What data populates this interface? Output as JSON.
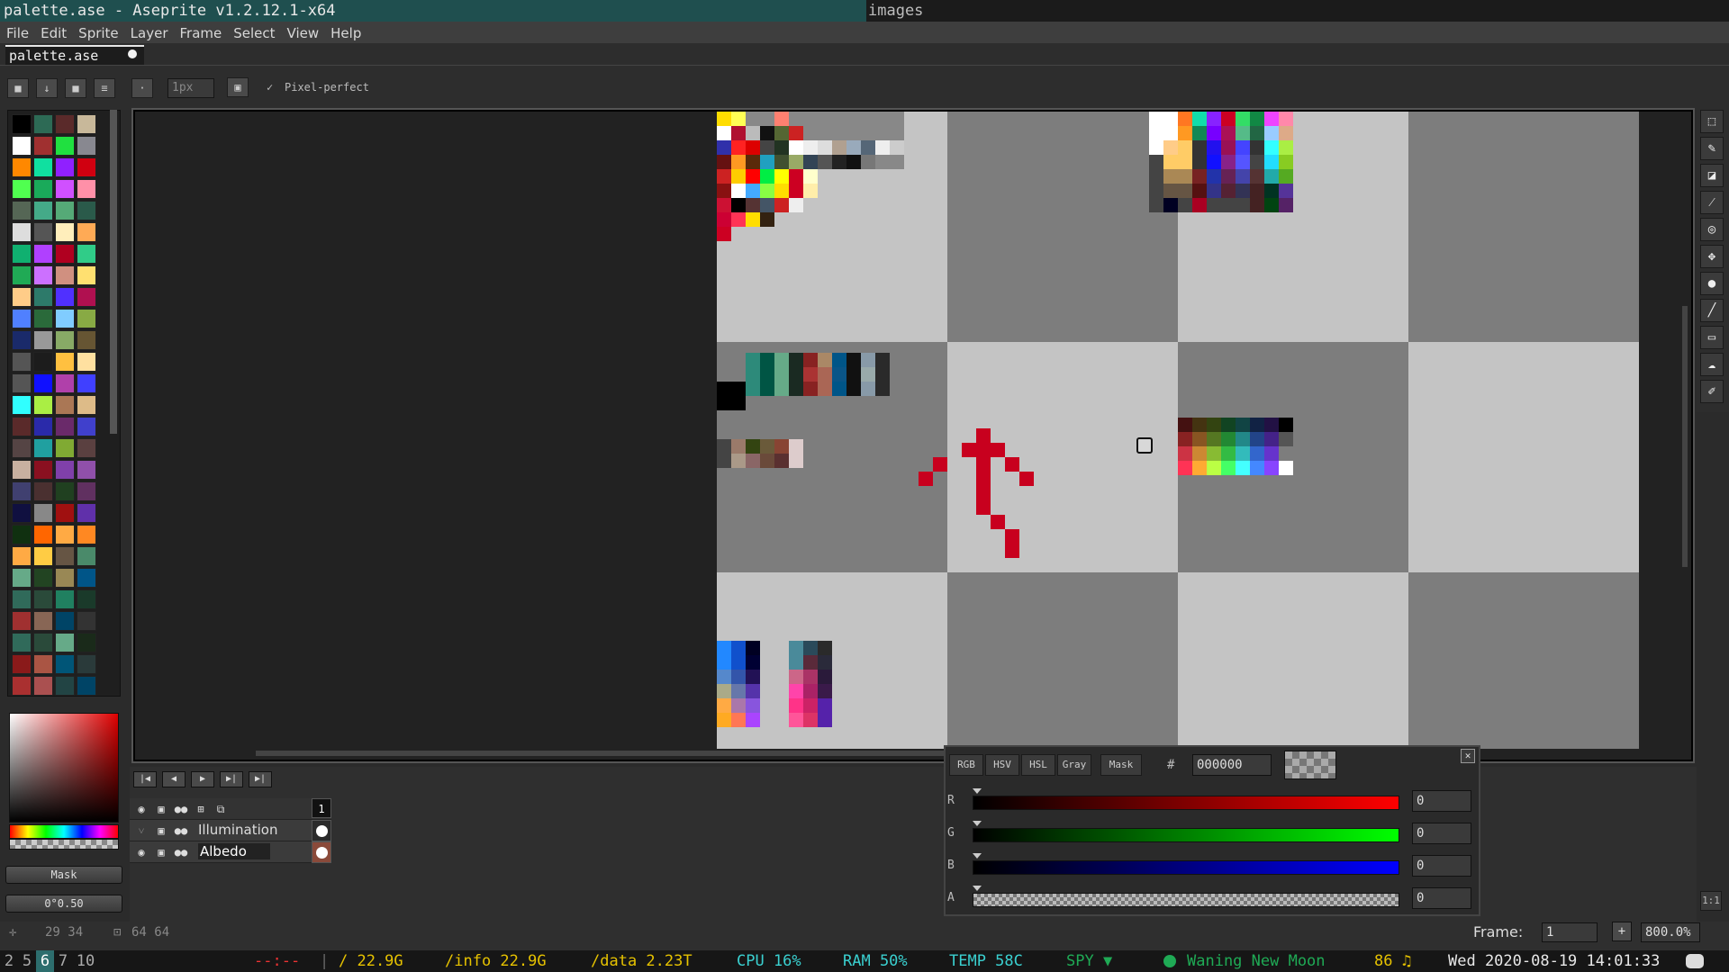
{
  "window": {
    "title": "palette.ase - Aseprite v1.2.12.1-x64",
    "right_title": "images"
  },
  "menu": [
    "File",
    "Edit",
    "Sprite",
    "Layer",
    "Frame",
    "Select",
    "View",
    "Help"
  ],
  "tab": {
    "label": "palette.ase"
  },
  "context_bar": {
    "brush_size": "1px",
    "pixel_perfect_label": "Pixel-perfect"
  },
  "side_buttons": {
    "mask": "Mask",
    "angle": "0°0.50"
  },
  "layers": [
    {
      "name": "Illumination"
    },
    {
      "name": "Albedo"
    }
  ],
  "frame_header": "1",
  "color_dialog": {
    "modes": [
      "RGB",
      "HSV",
      "HSL",
      "Gray",
      "Mask"
    ],
    "hex_label": "#",
    "hex_value": "000000",
    "channels": [
      {
        "label": "R",
        "value": "0"
      },
      {
        "label": "G",
        "value": "0"
      },
      {
        "label": "B",
        "value": "0"
      },
      {
        "label": "A",
        "value": "0"
      }
    ]
  },
  "status": {
    "cursor": "29 34",
    "size": "64 64",
    "frame_label": "Frame:",
    "frame_value": "1",
    "zoom": "800.0%"
  },
  "sysbar": {
    "workspaces": [
      "2",
      "5",
      "6",
      "7",
      "10"
    ],
    "active_workspace": "6",
    "clock_dashes": "--:--",
    "root": "/ 22.9G",
    "info": "/info 22.9G",
    "data": "/data 2.23T",
    "cpu": "CPU 16%",
    "ram": "RAM 50%",
    "temp": "TEMP 58C",
    "spy": "SPY ▼",
    "moon": "Waning New Moon",
    "volume": "86 ♫",
    "datetime": "Wed 2020-08-19 14:01:33"
  },
  "colors": {
    "title_bg": "#1f4f4f",
    "accent_teal": "#2d6e6e",
    "status_green": "#1faa55",
    "status_red": "#e33",
    "status_yellow": "#e6c200",
    "status_cyan": "#3ad0d0",
    "ink_red": "#c8001e"
  },
  "icons": [
    "lock-icon",
    "arrow-down-icon",
    "square-icon",
    "menu-icon",
    "dot-icon",
    "brush-icon",
    "marquee-icon",
    "pencil-icon",
    "eraser-icon",
    "eyedropper-icon",
    "zoom-icon",
    "move-icon",
    "fill-icon",
    "line-icon",
    "rectangle-icon",
    "blur-icon",
    "paint-icon",
    "eye-icon",
    "play-icon",
    "close-icon",
    "discord-icon"
  ]
}
